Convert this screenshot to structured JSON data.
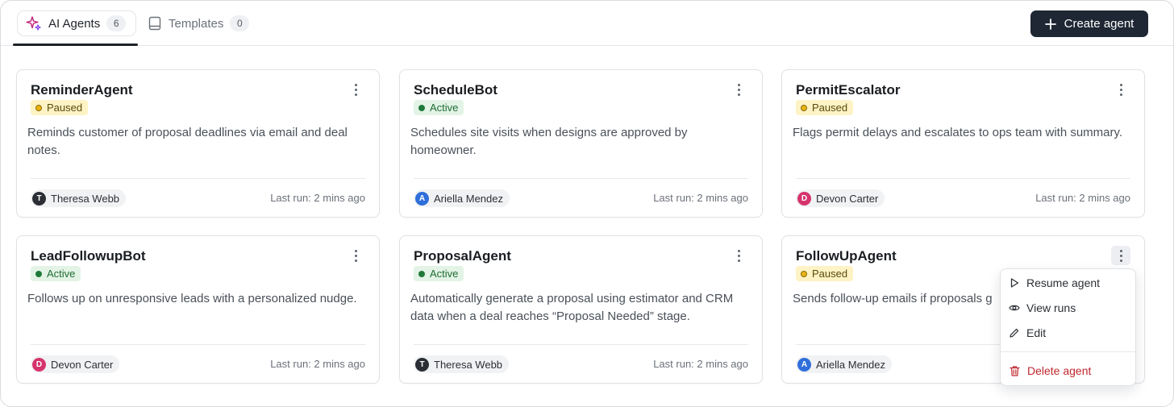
{
  "tabs": [
    {
      "label": "AI Agents",
      "count": "6"
    },
    {
      "label": "Templates",
      "count": "0"
    }
  ],
  "create_button": {
    "label": "Create agent"
  },
  "cards": [
    {
      "title": "ReminderAgent",
      "status": "Paused",
      "description": "Reminds customer of proposal deadlines via email and deal notes.",
      "owner": "Theresa Webb",
      "owner_initial": "T",
      "last_run": "Last run: 2 mins ago"
    },
    {
      "title": "ScheduleBot",
      "status": "Active",
      "description": "Schedules site visits when designs are approved by homeowner.",
      "owner": "Ariella Mendez",
      "owner_initial": "A",
      "last_run": "Last run: 2 mins ago"
    },
    {
      "title": "PermitEscalator",
      "status": "Paused",
      "description": "Flags permit delays and escalates to ops team with summary.",
      "owner": "Devon Carter",
      "owner_initial": "D",
      "last_run": "Last run: 2 mins ago"
    },
    {
      "title": "LeadFollowupBot",
      "status": "Active",
      "description": "Follows up on unresponsive leads with a personalized nudge.",
      "owner": "Devon Carter",
      "owner_initial": "D",
      "last_run": "Last run: 2 mins ago"
    },
    {
      "title": "ProposalAgent",
      "status": "Active",
      "description": "Automatically generate a proposal using estimator and CRM data when a deal reaches “Proposal Needed” stage.",
      "owner": "Theresa Webb",
      "owner_initial": "T",
      "last_run": "Last run: 2 mins ago"
    },
    {
      "title": "FollowUpAgent",
      "status": "Paused",
      "description": "Sends follow-up emails if proposals g",
      "owner": "Ariella Mendez",
      "owner_initial": "A",
      "last_run": ""
    }
  ],
  "menu": {
    "items": [
      {
        "label": "Resume agent",
        "icon": "play-icon"
      },
      {
        "label": "View runs",
        "icon": "eye-icon"
      },
      {
        "label": "Edit",
        "icon": "pencil-icon"
      },
      {
        "label": "Delete agent",
        "icon": "trash-icon"
      }
    ]
  },
  "colors": {
    "accent_dark": "#1e2733",
    "paused_bg": "#fdf3c4",
    "active_bg": "#e3f4e6",
    "danger": "#c0272d",
    "avatar_T": "#2b2f35",
    "avatar_A": "#2f6fdb",
    "avatar_D": "#d6336c",
    "sparkle": "#c2227a"
  }
}
